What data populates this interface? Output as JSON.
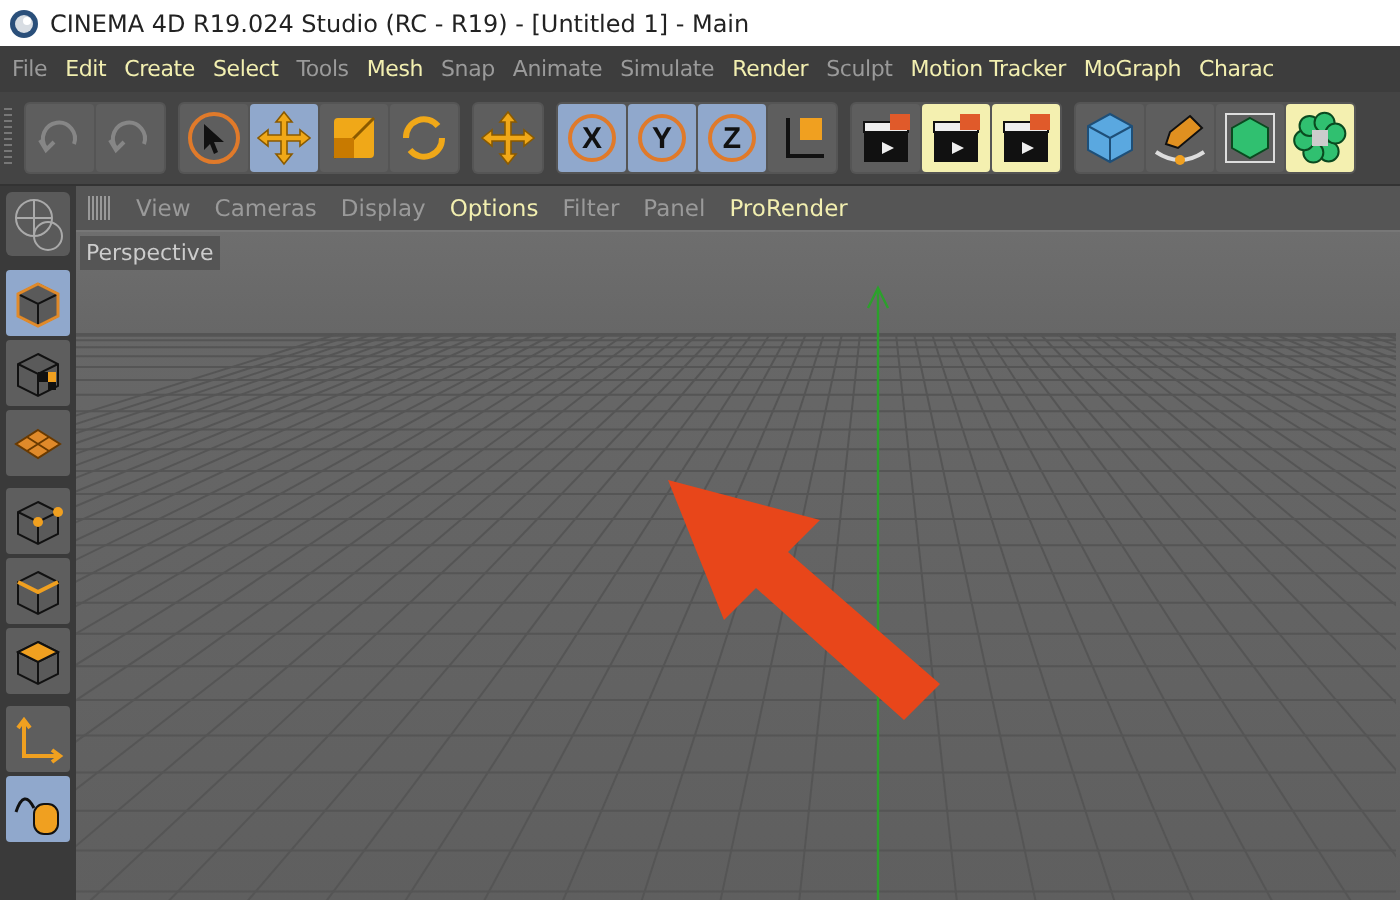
{
  "window": {
    "title": "CINEMA 4D R19.024 Studio (RC - R19) - [Untitled 1] - Main"
  },
  "menu": [
    {
      "label": "File",
      "highlighted": false
    },
    {
      "label": "Edit",
      "highlighted": true
    },
    {
      "label": "Create",
      "highlighted": true
    },
    {
      "label": "Select",
      "highlighted": true
    },
    {
      "label": "Tools",
      "highlighted": false
    },
    {
      "label": "Mesh",
      "highlighted": true
    },
    {
      "label": "Snap",
      "highlighted": false
    },
    {
      "label": "Animate",
      "highlighted": false
    },
    {
      "label": "Simulate",
      "highlighted": false
    },
    {
      "label": "Render",
      "highlighted": true
    },
    {
      "label": "Sculpt",
      "highlighted": false
    },
    {
      "label": "Motion Tracker",
      "highlighted": true
    },
    {
      "label": "MoGraph",
      "highlighted": true
    },
    {
      "label": "Charac",
      "highlighted": true
    }
  ],
  "toolbar": [
    {
      "buttons": [
        {
          "kind": "undo",
          "selected": false,
          "highlighted": false,
          "disabled": true
        },
        {
          "kind": "redo",
          "selected": false,
          "highlighted": false,
          "disabled": true
        }
      ]
    },
    {
      "buttons": [
        {
          "kind": "select",
          "selected": false,
          "highlighted": false,
          "disabled": false
        },
        {
          "kind": "move",
          "selected": true,
          "highlighted": false,
          "disabled": false
        },
        {
          "kind": "scale",
          "selected": false,
          "highlighted": false,
          "disabled": false
        },
        {
          "kind": "rotate",
          "selected": false,
          "highlighted": false,
          "disabled": false
        }
      ]
    },
    {
      "buttons": [
        {
          "kind": "move",
          "selected": false,
          "highlighted": false,
          "disabled": false
        }
      ]
    },
    {
      "buttons": [
        {
          "kind": "letter",
          "label": "X",
          "selected": true,
          "highlighted": false,
          "disabled": false
        },
        {
          "kind": "letter",
          "label": "Y",
          "selected": true,
          "highlighted": false,
          "disabled": false
        },
        {
          "kind": "letter",
          "label": "Z",
          "selected": true,
          "highlighted": false,
          "disabled": false
        },
        {
          "kind": "axis",
          "selected": false,
          "highlighted": false,
          "disabled": false
        }
      ]
    },
    {
      "buttons": [
        {
          "kind": "clapper",
          "selected": false,
          "highlighted": false,
          "disabled": false
        },
        {
          "kind": "clapper",
          "selected": false,
          "highlighted": true,
          "disabled": false
        },
        {
          "kind": "clapper",
          "selected": false,
          "highlighted": true,
          "disabled": false
        }
      ]
    },
    {
      "buttons": [
        {
          "kind": "cube",
          "selected": false,
          "highlighted": false,
          "disabled": false
        },
        {
          "kind": "pen",
          "selected": false,
          "highlighted": false,
          "disabled": false
        },
        {
          "kind": "greencube",
          "selected": false,
          "highlighted": false,
          "disabled": false
        },
        {
          "kind": "flower",
          "selected": false,
          "highlighted": true,
          "disabled": false
        }
      ]
    }
  ],
  "sidebar": [
    {
      "buttons": [
        {
          "kind": "model",
          "selected": true
        },
        {
          "kind": "texture",
          "selected": false
        },
        {
          "kind": "workplane",
          "selected": false
        }
      ]
    },
    {
      "buttons": [
        {
          "kind": "points",
          "selected": false
        },
        {
          "kind": "edges",
          "selected": false
        },
        {
          "kind": "polygons",
          "selected": false
        }
      ]
    },
    {
      "buttons": [
        {
          "kind": "axis",
          "selected": false
        },
        {
          "kind": "mouse",
          "selected": true
        }
      ]
    }
  ],
  "viewport": {
    "menu": [
      {
        "label": "View",
        "highlighted": false
      },
      {
        "label": "Cameras",
        "highlighted": false
      },
      {
        "label": "Display",
        "highlighted": false
      },
      {
        "label": "Options",
        "highlighted": true
      },
      {
        "label": "Filter",
        "highlighted": false
      },
      {
        "label": "Panel",
        "highlighted": false
      },
      {
        "label": "ProRender",
        "highlighted": true
      }
    ],
    "camera": "Perspective"
  }
}
